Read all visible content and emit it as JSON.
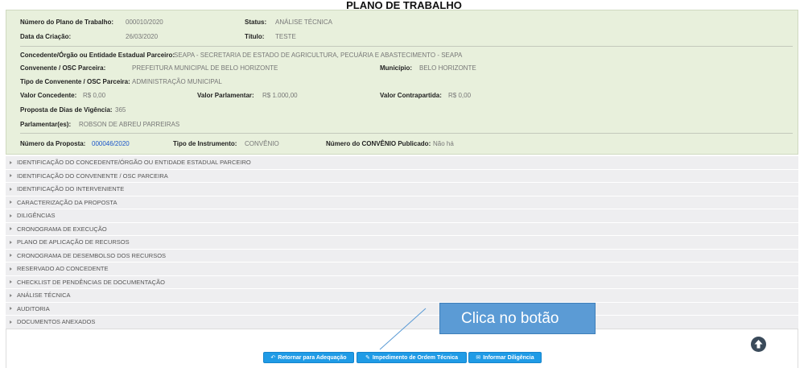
{
  "page_title": "PLANO DE TRABALHO",
  "info": {
    "numero_plano_label": "Número do Plano de Trabalho:",
    "numero_plano_value": "000010/2020",
    "status_label": "Status:",
    "status_value": "ANÁLISE TÉCNICA",
    "data_criacao_label": "Data da Criação:",
    "data_criacao_value": "26/03/2020",
    "titulo_label": "Título:",
    "titulo_value": "TESTE",
    "concedente_label": "Concedente/Órgão ou Entidade Estadual Parceiro:",
    "concedente_value": "SEAPA - SECRETARIA DE ESTADO DE AGRICULTURA, PECUÁRIA E ABASTECIMENTO - SEAPA",
    "convenente_label": "Convenente / OSC Parceira:",
    "convenente_value": "PREFEITURA MUNICIPAL DE BELO HORIZONTE",
    "municipio_label": "Município:",
    "municipio_value": "BELO HORIZONTE",
    "tipo_convenente_label": "Tipo de Convenente / OSC Parceira:",
    "tipo_convenente_value": "ADMINISTRAÇÃO MUNICIPAL",
    "valor_concedente_label": "Valor Concedente:",
    "valor_concedente_value": "R$ 0,00",
    "valor_parlamentar_label": "Valor Parlamentar:",
    "valor_parlamentar_value": "R$ 1.000,00",
    "valor_contrapartida_label": "Valor Contrapartida:",
    "valor_contrapartida_value": "R$ 0,00",
    "proposta_dias_label": "Proposta de Dias de Vigência:",
    "proposta_dias_value": "365",
    "parlamentar_label": "Parlamentar(es):",
    "parlamentar_value": "ROBSON DE ABREU PARREIRAS",
    "numero_proposta_label": "Número da Proposta:",
    "numero_proposta_value": "000046/2020",
    "tipo_instrumento_label": "Tipo de Instrumento:",
    "tipo_instrumento_value": "CONVÊNIO",
    "numero_convenio_label": "Número do CONVÊNIO Publicado:",
    "numero_convenio_value": "Não há"
  },
  "accordion": [
    "IDENTIFICAÇÃO DO CONCEDENTE/ÓRGÃO OU ENTIDADE ESTADUAL PARCEIRO",
    "IDENTIFICAÇÃO DO CONVENENTE / OSC PARCEIRA",
    "IDENTIFICAÇÃO DO INTERVENIENTE",
    "CARACTERIZAÇÃO DA PROPOSTA",
    "DILIGÊNCIAS",
    "CRONOGRAMA DE EXECUÇÃO",
    "PLANO DE APLICAÇÃO DE RECURSOS",
    "CRONOGRAMA DE DESEMBOLSO DOS RECURSOS",
    "RESERVADO AO CONCEDENTE",
    "CHECKLIST DE PENDÊNCIAS DE DOCUMENTAÇÃO",
    "ANÁLISE TÉCNICA",
    "AUDITORIA",
    "DOCUMENTOS ANEXADOS"
  ],
  "buttons": {
    "retornar": "Retornar para Adequação",
    "impedimento": "Impedimento de Ordem Técnica",
    "diligencia": "Informar Diligência"
  },
  "callout": "Clica no botão",
  "colors": {
    "panel_bg": "#e8f0dc",
    "button_blue": "#1f9be6",
    "callout_blue": "#5b9bd5"
  }
}
